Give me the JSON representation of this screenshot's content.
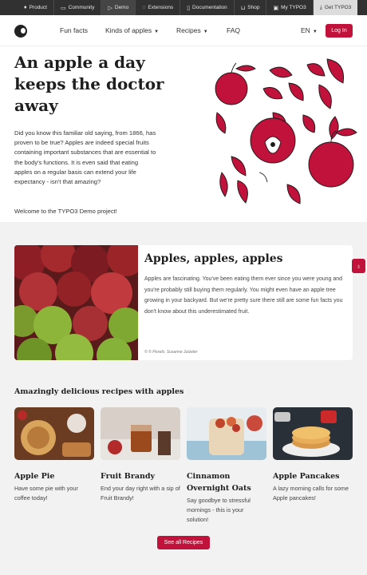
{
  "topbar": {
    "items": [
      {
        "label": "Product",
        "icon": "flame-icon"
      },
      {
        "label": "Community",
        "icon": "chat-icon"
      },
      {
        "label": "Demo",
        "icon": "play-icon"
      },
      {
        "label": "Extensions",
        "icon": "puzzle-icon"
      },
      {
        "label": "Documentation",
        "icon": "document-icon"
      },
      {
        "label": "Shop",
        "icon": "cart-icon"
      },
      {
        "label": "My TYPO3",
        "icon": "profile-icon"
      },
      {
        "label": "Get TYPO3",
        "icon": "download-icon"
      }
    ]
  },
  "nav": {
    "links": [
      "Fun facts",
      "Kinds of apples",
      "Recipes",
      "FAQ"
    ],
    "language": "EN",
    "login": "Log In"
  },
  "hero": {
    "title": "An apple a day keeps the doctor away",
    "paragraph": "Did you know this familiar old saying, from 1866, has proven to be true? Apples are indeed special fruits containing important substances that are essential to the body's functions. It is even said that eating apples on a regular basis can extend your life expectancy - isn't that amazing?",
    "welcome": "Welcome to the TYPO3 Demo project!"
  },
  "feature": {
    "title": "Apples, apples, apples",
    "text": "Apples are fascinating. You've been eating them ever since you were young and you're probably still buying them regularly. You might even have an apple tree growing in your backyard. But we're pretty sure there still are some fun facts you don't know about this underestimated fruit.",
    "credit": "© © Pexels, Susanne Jutzeler"
  },
  "recipes": {
    "title": "Amazingly delicious recipes with apples",
    "items": [
      {
        "name": "Apple Pie",
        "desc": "Have some pie with your coffee today!"
      },
      {
        "name": "Fruit Brandy",
        "desc": "End your day right with a sip of Fruit Brandy!"
      },
      {
        "name": "Cinnamon Overnight Oats",
        "desc": "Say goodbye to stressful mornings - this is your solution!"
      },
      {
        "name": "Apple Pancakes",
        "desc": "A lazy morning calls for some Apple pancakes!"
      }
    ],
    "see_all": "See all Recipes"
  },
  "colors": {
    "accent": "#c0123a",
    "topbar": "#313131"
  }
}
